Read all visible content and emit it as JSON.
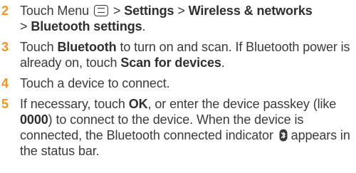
{
  "accent_color": "#f7941d",
  "text_color": "#3a3a3a",
  "steps": [
    {
      "number": "2",
      "t1": "Touch Menu",
      "t2": ">",
      "b1": "Settings",
      "t3": ">",
      "b2": "Wireless & networks",
      "t4": ">",
      "b3": "Bluetooth settings",
      "t5": "."
    },
    {
      "number": "3",
      "t1": "Touch",
      "b1": "Bluetooth",
      "t2": "to turn on and scan. If Bluetooth power is already on, touch",
      "b2": "Scan for devices",
      "t3": "."
    },
    {
      "number": "4",
      "t1": "Touch a device to connect."
    },
    {
      "number": "5",
      "t1": "If necessary, touch",
      "b1": "OK",
      "t2": ", or enter the device passkey (like",
      "b2": "0000",
      "t3": ") to connect to the device. When the device is connected, the Bluetooth connected indicator",
      "t4": "appears in the status bar."
    }
  ]
}
